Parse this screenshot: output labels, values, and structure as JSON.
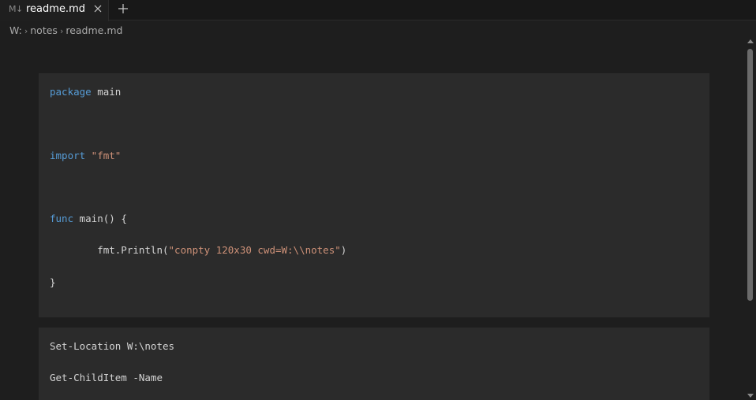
{
  "tabs": [
    {
      "icon": "markdown-icon",
      "icon_text": "M↓",
      "label": "readme.md",
      "active": true
    }
  ],
  "new_tab": {
    "icon": "plus-icon"
  },
  "breadcrumb": {
    "items": [
      "W:",
      "notes",
      "readme.md"
    ],
    "separator": "›"
  },
  "code_blocks": [
    {
      "lines": [
        {
          "kw": "package",
          "rest": " main"
        },
        {
          "kw": "import",
          "str": " \"fmt\""
        },
        {
          "kw": "func",
          "rest": " main() {"
        },
        {
          "rest": "        fmt.Println(",
          "str": "\"conpty 120x30 cwd=W:\\\\notes\"",
          "rest2": ")"
        },
        {
          "rest": "}"
        }
      ]
    },
    {
      "lines": [
        {
          "rest": "Set-Location W:\\notes"
        },
        {
          "rest": "Get-ChildItem -Name"
        }
      ]
    }
  ],
  "colors": {
    "background": "#1e1e1e",
    "code_block": "#2b2b2b",
    "keyword": "#569cd6",
    "string": "#ce9178",
    "text": "#d4d4d4"
  }
}
